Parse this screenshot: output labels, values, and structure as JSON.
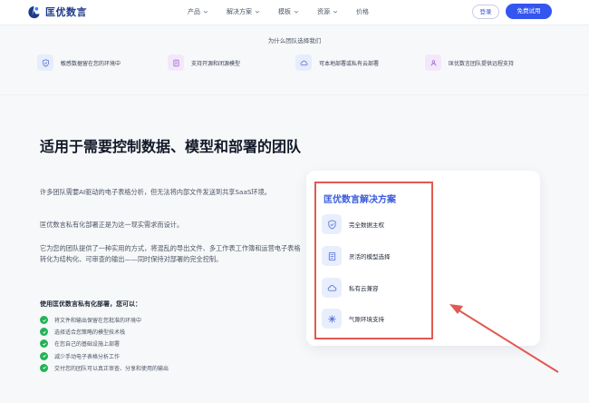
{
  "nav": {
    "logo_text": "匡优数言",
    "menu": [
      {
        "label": "产品",
        "has_dropdown": true
      },
      {
        "label": "解决方案",
        "has_dropdown": true
      },
      {
        "label": "模板",
        "has_dropdown": true
      },
      {
        "label": "资源",
        "has_dropdown": true
      },
      {
        "label": "价格",
        "has_dropdown": false
      }
    ],
    "login_label": "登录",
    "trial_label": "免费试用"
  },
  "why": {
    "title": "为什么团队选择我们",
    "features": [
      {
        "icon": "shield-check-icon",
        "label": "敏感数据留在您的环境中"
      },
      {
        "icon": "document-list-icon",
        "label": "支持开源和闭源模型"
      },
      {
        "icon": "cloud-icon",
        "label": "可本地部署或私有云部署"
      },
      {
        "icon": "people-icon",
        "label": "匡优数言团队提供远程支持"
      }
    ]
  },
  "main": {
    "headline": "适用于需要控制数据、模型和部署的团队",
    "paragraphs": [
      "许多团队需要AI驱动的电子表格分析，但无法将内部文件发送到共享SaaS环境。",
      "匡优数言私有化部署正是为这一现实需求而设计。",
      "它为您的团队提供了一种实用的方式，将混乱的导出文件、多工作表工作簿和运营电子表格转化为结构化、可审查的输出——同时保持对部署的完全控制。"
    ],
    "use_title": "使用匡优数言私有化部署，您可以：",
    "checklist": [
      "将文件和输出保留在您批准的环境中",
      "选择适合您策略的模型技术栈",
      "在您自己的基础设施上部署",
      "减少手动电子表格分析工作",
      "交付您的团队可以真正审查、分享和使用的输出"
    ]
  },
  "card": {
    "title": "匡优数言解决方案",
    "items": [
      {
        "icon": "shield-check-icon",
        "label": "完全数据主权"
      },
      {
        "icon": "document-list-icon",
        "label": "灵活的模型选择"
      },
      {
        "icon": "cloud-icon",
        "label": "私有云兼容"
      },
      {
        "icon": "sparkle-icon",
        "label": "气隙环境支持"
      }
    ]
  },
  "colors": {
    "brand": "#3355f0",
    "annotation": "#e05a52",
    "check": "#22b357"
  }
}
